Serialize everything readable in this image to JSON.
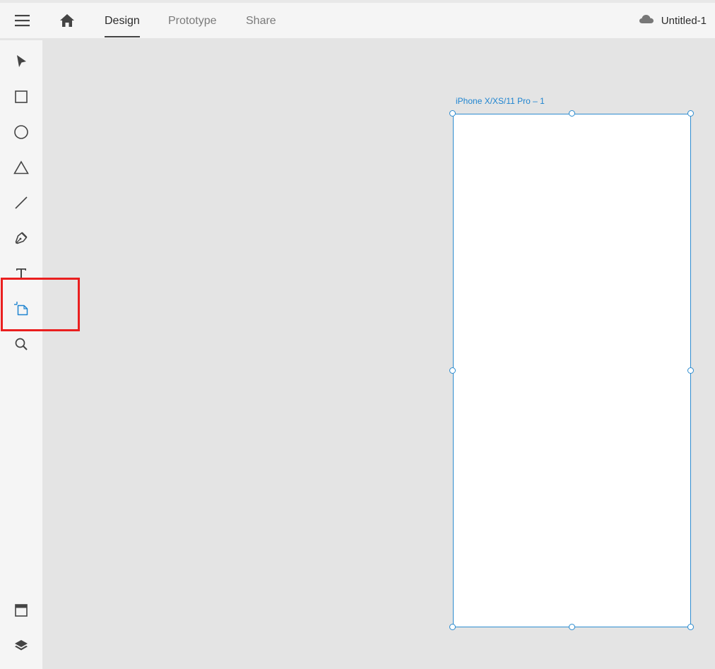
{
  "header": {
    "menu_icon": "hamburger-menu-icon",
    "home_icon": "home-icon",
    "tabs": [
      {
        "label": "Design",
        "active": true
      },
      {
        "label": "Prototype",
        "active": false
      },
      {
        "label": "Share",
        "active": false
      }
    ],
    "document": {
      "cloud_icon": "cloud-icon",
      "title": "Untitled-1"
    }
  },
  "toolbar": {
    "tools": [
      {
        "name": "select",
        "icon": "arrow-pointer-icon"
      },
      {
        "name": "rectangle",
        "icon": "rectangle-icon"
      },
      {
        "name": "ellipse",
        "icon": "ellipse-icon"
      },
      {
        "name": "polygon",
        "icon": "triangle-icon"
      },
      {
        "name": "line",
        "icon": "line-icon"
      },
      {
        "name": "pen",
        "icon": "pen-icon"
      },
      {
        "name": "text",
        "icon": "text-icon"
      },
      {
        "name": "artboard",
        "icon": "artboard-icon",
        "active": true,
        "highlighted": true
      },
      {
        "name": "zoom",
        "icon": "zoom-icon"
      }
    ],
    "bottom_tools": [
      {
        "name": "assets",
        "icon": "assets-panel-icon"
      },
      {
        "name": "layers",
        "icon": "layers-icon"
      }
    ]
  },
  "canvas": {
    "artboard": {
      "label": "iPhone X/XS/11 Pro – 1",
      "selected": true
    }
  },
  "colors": {
    "accent": "#2d8ccf",
    "artboard_label": "#1e84d0",
    "highlight": "#ea1f1f",
    "canvas_bg": "#e4e4e4",
    "panel_bg": "#f5f5f5"
  }
}
